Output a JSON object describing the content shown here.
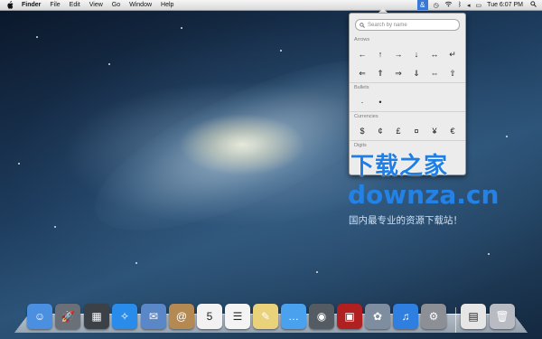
{
  "menubar": {
    "app_name": "Finder",
    "items": [
      "File",
      "Edit",
      "View",
      "Go",
      "Window",
      "Help"
    ],
    "clock": "Tue 6:07 PM",
    "char_menu_symbol": "&"
  },
  "character_viewer": {
    "search_placeholder": "Search by name",
    "sections": [
      {
        "title": "Arrows",
        "rows": [
          [
            "←",
            "↑",
            "→",
            "↓",
            "↔",
            "↵"
          ],
          [
            "⇐",
            "⇑",
            "⇒",
            "⇓",
            "⇔",
            "⇧"
          ]
        ]
      },
      {
        "title": "Bullets",
        "rows": [
          [
            "·",
            "•"
          ]
        ]
      },
      {
        "title": "Currencies",
        "rows": [
          [
            "$",
            "¢",
            "£",
            "¤",
            "¥",
            "€"
          ]
        ]
      },
      {
        "title": "Digits",
        "rows": []
      }
    ]
  },
  "watermark": {
    "title": "下载之家",
    "url": "downza.cn",
    "subtitle": "国内最专业的资源下载站！"
  },
  "dock": {
    "items": [
      {
        "name": "finder-icon",
        "glyph": "☺",
        "bg": "#4a8fe0"
      },
      {
        "name": "launchpad-icon",
        "glyph": "🚀",
        "bg": "#6a6f78"
      },
      {
        "name": "mission-control-icon",
        "glyph": "▦",
        "bg": "#3c4148"
      },
      {
        "name": "safari-icon",
        "glyph": "✧",
        "bg": "#2a8cea"
      },
      {
        "name": "mail-icon",
        "glyph": "✉",
        "bg": "#5a87c8"
      },
      {
        "name": "contacts-icon",
        "glyph": "@",
        "bg": "#b58a52"
      },
      {
        "name": "calendar-icon",
        "glyph": "5",
        "bg": "#f2f2f2"
      },
      {
        "name": "reminders-icon",
        "glyph": "☰",
        "bg": "#f4f4f4"
      },
      {
        "name": "notes-icon",
        "glyph": "✎",
        "bg": "#e9d27a"
      },
      {
        "name": "messages-icon",
        "glyph": "…",
        "bg": "#4aa1ee"
      },
      {
        "name": "facetime-icon",
        "glyph": "◉",
        "bg": "#555b63"
      },
      {
        "name": "photo-booth-icon",
        "glyph": "▣",
        "bg": "#b02020"
      },
      {
        "name": "iphoto-icon",
        "glyph": "✿",
        "bg": "#7e8ea0"
      },
      {
        "name": "itunes-icon",
        "glyph": "♫",
        "bg": "#2f7fe0"
      },
      {
        "name": "app-store-icon",
        "glyph": "⚙",
        "bg": "#8c8f95"
      },
      {
        "name": "documents-icon",
        "glyph": "▤",
        "bg": "#e6e6e6"
      },
      {
        "name": "trash-icon",
        "glyph": "🗑",
        "bg": "#b8bcc2"
      }
    ]
  }
}
